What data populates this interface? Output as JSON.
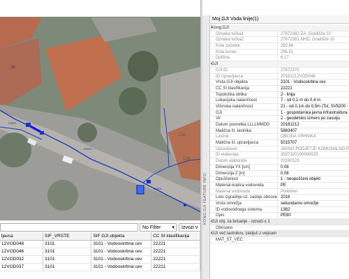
{
  "grid": {
    "filter_label": "No Filter",
    "export_label": "Izvozi v",
    "columns": [
      "ljavca",
      "SIF_VRSTE",
      "SIF GJI objekta",
      "CC SI klasifikacija"
    ],
    "rows": [
      [
        "12VOD048",
        "3101",
        "3101 - Vodooskrbna cev",
        "22221"
      ],
      [
        "12VOD046",
        "3101",
        "3101 - Vodooskrbna cev",
        "22221"
      ],
      [
        "12VOD032",
        "3101",
        "3101 - Vodooskrbna cev",
        "22221"
      ],
      [
        "12VOD037",
        "3101",
        "3101 - Vodooskrbna cev",
        "22221"
      ]
    ]
  },
  "map": {
    "labels": [
      "38",
      "13A",
      "13A"
    ]
  },
  "panel": {
    "title": "Moj.GJI Voda linije(1)",
    "side_label": "KONG.GJI FEATURE INFO",
    "sections": [
      {
        "header": "Kong.GJI",
        "rows": [
          {
            "k": "Oznaka točka1",
            "v": "27672382-ZA; Gradišče 10",
            "grey": true
          },
          {
            "k": "Oznaka točka2",
            "v": "27672381-NHD; Gradišče 10",
            "grey": true
          },
          {
            "k": "Kota začetek",
            "v": "292.66",
            "grey": true
          },
          {
            "k": "Kota konec",
            "v": "295.51",
            "grey": true
          },
          {
            "k": "Dolžina",
            "v": "6.17",
            "grey": true
          }
        ]
      },
      {
        "header": "GJI",
        "rows": [
          {
            "k": "GJI ID",
            "v": "27672370",
            "grey": true
          },
          {
            "k": "ID Upravljavca",
            "v": "20181212VOD048",
            "grey": true
          },
          {
            "k": "Vrsta GJI objekta",
            "v": "3101 - Vodooskrbna cev",
            "grey": false
          },
          {
            "k": "CC SI klasifikacija",
            "v": "22221",
            "grey": false
          },
          {
            "k": "Topološka oblika",
            "v": "2 - linija",
            "grey": false
          },
          {
            "k": "Lokacijska natančnost",
            "v": "7 - od 0,1 m do 0,4 m",
            "grey": false
          },
          {
            "k": "Višinska natančnost",
            "v": "21 - od 0,1m do 0,5m (Tst, SV5200 : vi",
            "grey": false
          },
          {
            "k": "GJI",
            "v": "1 - gospodarska javna infrastruktura",
            "grey": false
          },
          {
            "k": "Vir",
            "v": "2 - geodetsko izmero po zasutju",
            "grey": false
          },
          {
            "k": "Datum posnetka LLLLMMDD",
            "v": "20181212",
            "grey": false
          },
          {
            "k": "Matična št. lastnika",
            "v": "5883407",
            "grey": false
          },
          {
            "k": "Lastnik",
            "v": "OBČINA VRHNIKA",
            "grey": true
          },
          {
            "k": "Matična št. upravljavca",
            "v": "5015707",
            "grey": false
          },
          {
            "k": "Upravljavec",
            "v": "JAVNO PODJETJE KOMUNALNO PODJE",
            "grey": true
          },
          {
            "k": "ID elaborata",
            "v": "3537320190000023",
            "grey": true
          },
          {
            "k": "Datum elaborata",
            "v": "20190123",
            "grey": true
          },
          {
            "k": "Dimenzija YX [cm]",
            "v": "0.08",
            "grey": false
          },
          {
            "k": "Dimenzija Z [m]",
            "v": "0.08",
            "grey": false
          },
          {
            "k": "Opuščenost",
            "v": "1 - neopuščeni objekt",
            "grey": false
          },
          {
            "k": "Material-kratica vodovoda",
            "v": "PE",
            "grey": false
          },
          {
            "k": "Material vodovoda",
            "v": "Polietilen",
            "grey": true
          },
          {
            "k": "Leto izgradnje oz. zadnje obnove",
            "v": "2018",
            "grey": false
          },
          {
            "k": "Vrsta omrežja",
            "v": "sekundarno omrežje",
            "grey": false
          },
          {
            "k": "ID vodovodnega sistema",
            "v": "1382",
            "grey": false
          },
          {
            "k": "Opis",
            "v": "PE80",
            "grey": false
          }
        ]
      }
    ],
    "sub_sections": [
      {
        "header": "GJI obj. za brisanje - označi x 1",
        "rows": [
          {
            "k": "Obrisano",
            "v": ""
          }
        ]
      },
      {
        "header": "GJI več lastnikov, zaključ z vejicam",
        "rows": [
          {
            "k": "MAT_ST_VEC",
            "v": ""
          }
        ]
      }
    ]
  }
}
